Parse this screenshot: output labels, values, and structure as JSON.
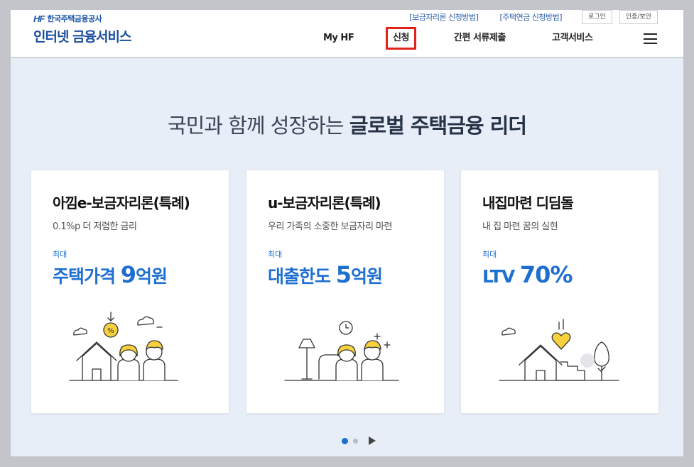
{
  "header": {
    "logo_mark": "HF",
    "org_name": "한국주택금융공사",
    "service_title": "인터넷 금융서비스",
    "util_links": [
      "[보금자리론 신청방법]",
      "[주택연금 신청방법]"
    ],
    "util_buttons": [
      "로그인",
      "인증/보안"
    ],
    "nav": [
      "My HF",
      "신청",
      "간편 서류제출",
      "고객서비스"
    ]
  },
  "main": {
    "headline_light": "국민과 함께 성장하는 ",
    "headline_bold": "글로벌 주택금융 리더",
    "cards": [
      {
        "title": "아낌e-보금자리론(특례)",
        "subtitle": "0.1%p 더 저렴한 금리",
        "max_label": "최대",
        "value_prefix": "주택가격 ",
        "value_num": "9",
        "value_suffix": "억원"
      },
      {
        "title": "u-보금자리론(특례)",
        "subtitle": "우리 가족의 소중한 보금자리 마련",
        "max_label": "최대",
        "value_prefix": "대출한도 ",
        "value_num": "5",
        "value_suffix": "억원"
      },
      {
        "title": "내집마련 디딤돌",
        "subtitle": "내 집 마련 꿈의 실현",
        "max_label": "최대",
        "value_prefix": "LTV ",
        "value_num": "70%",
        "value_suffix": ""
      }
    ]
  },
  "pager": {
    "total": 2,
    "current": 1
  },
  "colors": {
    "accent": "#1f6fd1",
    "brand": "#1c4e9e",
    "highlight_box": "#e2231a",
    "illustration_yellow": "#f7d23e"
  }
}
